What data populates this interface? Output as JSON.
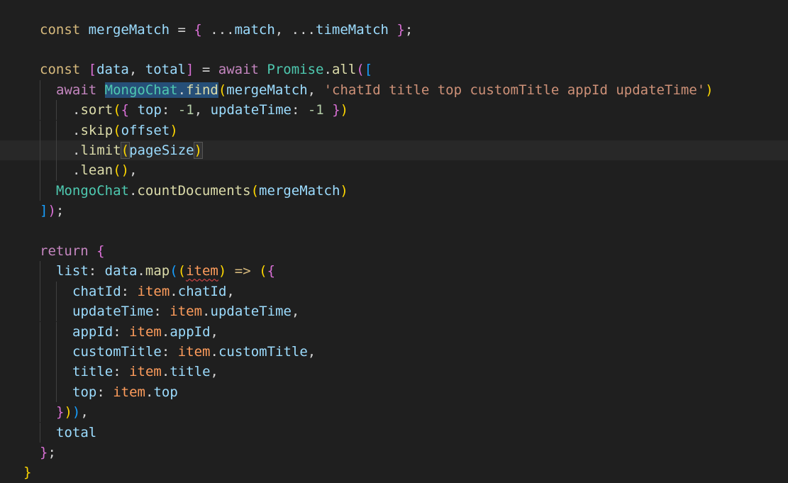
{
  "theme": {
    "background": "#1f1f1f",
    "current_line": "#282828",
    "guide": "#404040",
    "colors": {
      "kw": "#c586c0",
      "decl": "#d7ba7d",
      "var": "#9cdcfe",
      "fn": "#dcdcaa",
      "cls": "#4ec9b0",
      "str": "#ce9178",
      "num": "#b5cea8",
      "plain": "#d4d4d4",
      "param": "#ff9d5c",
      "bracket1": "#ffd700",
      "bracket2": "#da70d6",
      "bracket3": "#179fff"
    }
  },
  "editor": {
    "current_line": 6,
    "lines": [
      {
        "indent": 1,
        "tokens": [
          [
            "const",
            "decl"
          ],
          [
            " ",
            "plain"
          ],
          [
            "mergeMatch",
            "var"
          ],
          [
            " = ",
            "plain"
          ],
          [
            "{",
            "bracket2"
          ],
          [
            " ...",
            "plain"
          ],
          [
            "match",
            "var"
          ],
          [
            ", ...",
            "plain"
          ],
          [
            "timeMatch",
            "var"
          ],
          [
            " ",
            "plain"
          ],
          [
            "}",
            "bracket2"
          ],
          [
            ";",
            "plain"
          ]
        ]
      },
      {
        "indent": 0,
        "tokens": []
      },
      {
        "indent": 1,
        "tokens": [
          [
            "const",
            "decl"
          ],
          [
            " ",
            "plain"
          ],
          [
            "[",
            "bracket2"
          ],
          [
            "data",
            "var"
          ],
          [
            ", ",
            "plain"
          ],
          [
            "total",
            "var"
          ],
          [
            "]",
            "bracket2"
          ],
          [
            " = ",
            "plain"
          ],
          [
            "await",
            "kw"
          ],
          [
            " ",
            "plain"
          ],
          [
            "Promise",
            "cls"
          ],
          [
            ".",
            "plain"
          ],
          [
            "all",
            "fn"
          ],
          [
            "(",
            "bracket2"
          ],
          [
            "[",
            "bracket3"
          ]
        ]
      },
      {
        "indent": 2,
        "tokens": [
          [
            "await",
            "kw"
          ],
          [
            " ",
            "plain"
          ],
          [
            "MongoChat",
            "cls",
            "sel"
          ],
          [
            ".",
            "plain",
            "sel"
          ],
          [
            "find",
            "fn",
            "sel"
          ],
          [
            "(",
            "bracket1"
          ],
          [
            "mergeMatch",
            "var"
          ],
          [
            ", ",
            "plain"
          ],
          [
            "'chatId title top customTitle appId updateTime'",
            "str"
          ],
          [
            ")",
            "bracket1"
          ]
        ]
      },
      {
        "indent": 3,
        "tokens": [
          [
            ".",
            "plain"
          ],
          [
            "sort",
            "fn"
          ],
          [
            "(",
            "bracket1"
          ],
          [
            "{",
            "bracket2"
          ],
          [
            " ",
            "plain"
          ],
          [
            "top",
            "var"
          ],
          [
            ": ",
            "plain"
          ],
          [
            "-1",
            "num"
          ],
          [
            ", ",
            "plain"
          ],
          [
            "updateTime",
            "var"
          ],
          [
            ": ",
            "plain"
          ],
          [
            "-1",
            "num"
          ],
          [
            " ",
            "plain"
          ],
          [
            "}",
            "bracket2"
          ],
          [
            ")",
            "bracket1"
          ]
        ]
      },
      {
        "indent": 3,
        "tokens": [
          [
            ".",
            "plain"
          ],
          [
            "skip",
            "fn"
          ],
          [
            "(",
            "bracket1"
          ],
          [
            "offset",
            "var"
          ],
          [
            ")",
            "bracket1"
          ]
        ]
      },
      {
        "indent": 3,
        "tokens": [
          [
            ".",
            "plain"
          ],
          [
            "limit",
            "fn"
          ],
          [
            "(",
            "bracket1",
            "word"
          ],
          [
            "pageSize",
            "var"
          ],
          [
            ")",
            "bracket1",
            "word"
          ]
        ]
      },
      {
        "indent": 3,
        "tokens": [
          [
            ".",
            "plain"
          ],
          [
            "lean",
            "fn"
          ],
          [
            "(",
            "bracket1"
          ],
          [
            ")",
            "bracket1"
          ],
          [
            ",",
            "plain"
          ]
        ]
      },
      {
        "indent": 2,
        "tokens": [
          [
            "MongoChat",
            "cls"
          ],
          [
            ".",
            "plain"
          ],
          [
            "countDocuments",
            "fn"
          ],
          [
            "(",
            "bracket1"
          ],
          [
            "mergeMatch",
            "var"
          ],
          [
            ")",
            "bracket1"
          ]
        ]
      },
      {
        "indent": 1,
        "tokens": [
          [
            "]",
            "bracket3"
          ],
          [
            ")",
            "bracket2"
          ],
          [
            ";",
            "plain"
          ]
        ]
      },
      {
        "indent": 0,
        "tokens": []
      },
      {
        "indent": 1,
        "tokens": [
          [
            "return",
            "kw"
          ],
          [
            " ",
            "plain"
          ],
          [
            "{",
            "bracket2"
          ]
        ]
      },
      {
        "indent": 2,
        "tokens": [
          [
            "list",
            "var"
          ],
          [
            ": ",
            "plain"
          ],
          [
            "data",
            "var"
          ],
          [
            ".",
            "plain"
          ],
          [
            "map",
            "fn"
          ],
          [
            "(",
            "bracket3"
          ],
          [
            "(",
            "bracket1"
          ],
          [
            "item",
            "param",
            "squiggle"
          ],
          [
            ")",
            "bracket1"
          ],
          [
            " ",
            "plain"
          ],
          [
            "=>",
            "decl"
          ],
          [
            " ",
            "plain"
          ],
          [
            "(",
            "bracket1"
          ],
          [
            "{",
            "bracket2"
          ]
        ]
      },
      {
        "indent": 3,
        "tokens": [
          [
            "chatId",
            "var"
          ],
          [
            ": ",
            "plain"
          ],
          [
            "item",
            "param"
          ],
          [
            ".",
            "plain"
          ],
          [
            "chatId",
            "var"
          ],
          [
            ",",
            "plain"
          ]
        ]
      },
      {
        "indent": 3,
        "tokens": [
          [
            "updateTime",
            "var"
          ],
          [
            ": ",
            "plain"
          ],
          [
            "item",
            "param"
          ],
          [
            ".",
            "plain"
          ],
          [
            "updateTime",
            "var"
          ],
          [
            ",",
            "plain"
          ]
        ]
      },
      {
        "indent": 3,
        "tokens": [
          [
            "appId",
            "var"
          ],
          [
            ": ",
            "plain"
          ],
          [
            "item",
            "param"
          ],
          [
            ".",
            "plain"
          ],
          [
            "appId",
            "var"
          ],
          [
            ",",
            "plain"
          ]
        ]
      },
      {
        "indent": 3,
        "tokens": [
          [
            "customTitle",
            "var"
          ],
          [
            ": ",
            "plain"
          ],
          [
            "item",
            "param"
          ],
          [
            ".",
            "plain"
          ],
          [
            "customTitle",
            "var"
          ],
          [
            ",",
            "plain"
          ]
        ]
      },
      {
        "indent": 3,
        "tokens": [
          [
            "title",
            "var"
          ],
          [
            ": ",
            "plain"
          ],
          [
            "item",
            "param"
          ],
          [
            ".",
            "plain"
          ],
          [
            "title",
            "var"
          ],
          [
            ",",
            "plain"
          ]
        ]
      },
      {
        "indent": 3,
        "tokens": [
          [
            "top",
            "var"
          ],
          [
            ": ",
            "plain"
          ],
          [
            "item",
            "param"
          ],
          [
            ".",
            "plain"
          ],
          [
            "top",
            "var"
          ]
        ]
      },
      {
        "indent": 2,
        "tokens": [
          [
            "}",
            "bracket2"
          ],
          [
            ")",
            "bracket1"
          ],
          [
            ")",
            "bracket3"
          ],
          [
            ",",
            "plain"
          ]
        ]
      },
      {
        "indent": 2,
        "tokens": [
          [
            "total",
            "var"
          ]
        ]
      },
      {
        "indent": 1,
        "tokens": [
          [
            "}",
            "bracket2"
          ],
          [
            ";",
            "plain"
          ]
        ]
      },
      {
        "indent": 0,
        "tokens": [
          [
            "}",
            "bracket1"
          ]
        ]
      }
    ]
  }
}
